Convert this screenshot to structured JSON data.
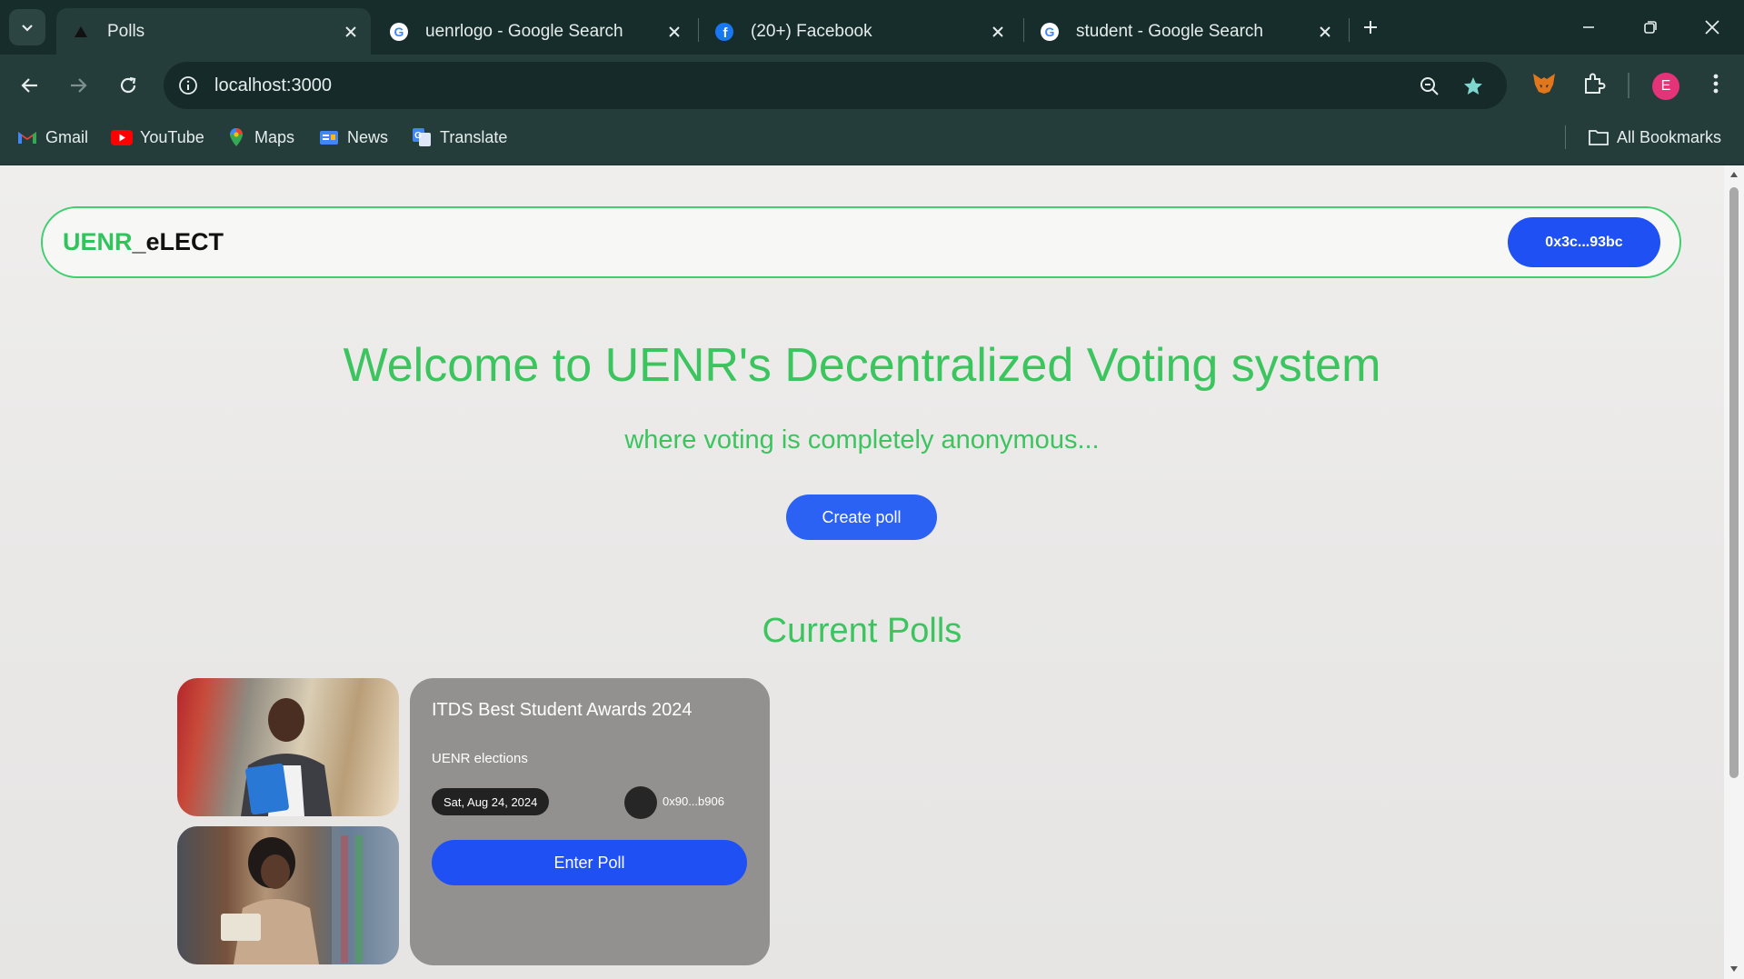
{
  "browser": {
    "tabs": [
      {
        "title": "Polls",
        "icon": "vercel-triangle-icon"
      },
      {
        "title": "uenrlogo - Google Search",
        "icon": "google-icon"
      },
      {
        "title": "(20+) Facebook",
        "icon": "facebook-icon"
      },
      {
        "title": "student - Google Search",
        "icon": "google-icon"
      }
    ],
    "url": "localhost:3000",
    "profile_initial": "E",
    "bookmarks": [
      "Gmail",
      "YouTube",
      "Maps",
      "News",
      "Translate"
    ],
    "all_bookmarks_label": "All Bookmarks"
  },
  "app": {
    "logo_part1": "UENR",
    "logo_part2": "_eLECT",
    "wallet_address": "0x3c...93bc",
    "hero_title": "Welcome to UENR's Decentralized Voting system",
    "hero_subtitle": "where voting is completely anonymous...",
    "create_poll_label": "Create poll",
    "current_polls_heading": "Current Polls",
    "polls": [
      {
        "title": "ITDS Best Student Awards 2024",
        "description": "UENR elections",
        "date": "Sat, Aug 24, 2024",
        "owner": "0x90...b906",
        "enter_label": "Enter Poll"
      }
    ]
  },
  "colors": {
    "accent_green": "#3cc45f",
    "button_blue": "#1f50f3",
    "browser_frame": "#243c3a"
  }
}
